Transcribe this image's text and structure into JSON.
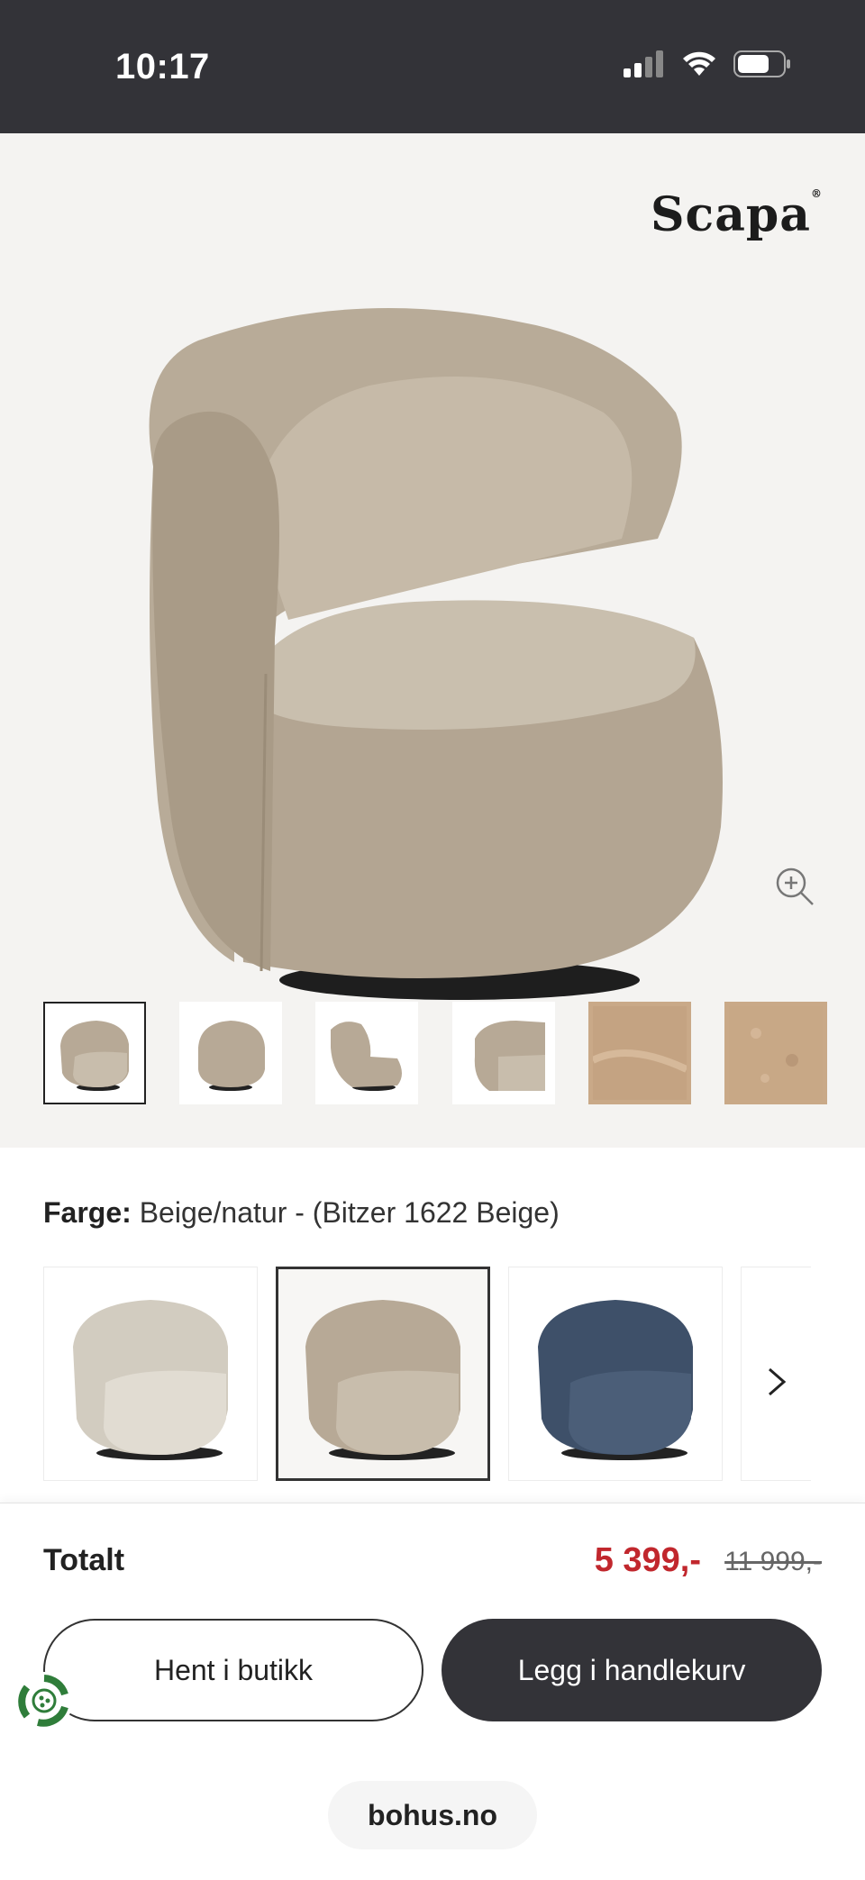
{
  "status_bar": {
    "time": "10:17",
    "icons": [
      "cellular-signal-icon",
      "wifi-icon",
      "battery-icon"
    ]
  },
  "gallery": {
    "brand": "Scapa",
    "thumbnails": [
      {
        "kind": "chair-front",
        "active": true
      },
      {
        "kind": "chair-back",
        "active": false
      },
      {
        "kind": "chair-side",
        "active": false
      },
      {
        "kind": "chair-angle",
        "active": false
      },
      {
        "kind": "fabric-swatch",
        "active": false
      },
      {
        "kind": "fabric-closeup",
        "active": false
      }
    ]
  },
  "color": {
    "label": "Farge:",
    "value": "Beige/natur - (Bitzer 1622 Beige)",
    "variants": [
      {
        "color": "#d7d2c7",
        "selected": false
      },
      {
        "color": "#b9ab98",
        "selected": true
      },
      {
        "color": "#3d4f68",
        "selected": false
      }
    ]
  },
  "footer": {
    "total_label": "Totalt",
    "price_now": "5 399,-",
    "price_old": "11 999,-",
    "pickup_button": "Hent i butikk",
    "cart_button": "Legg i handlekurv",
    "url": "bohus.no"
  },
  "colors": {
    "accent_price": "#c1272d",
    "dark": "#333338",
    "gallery_bg": "#f4f3f1",
    "chair_fabric": "#b9ab98"
  }
}
